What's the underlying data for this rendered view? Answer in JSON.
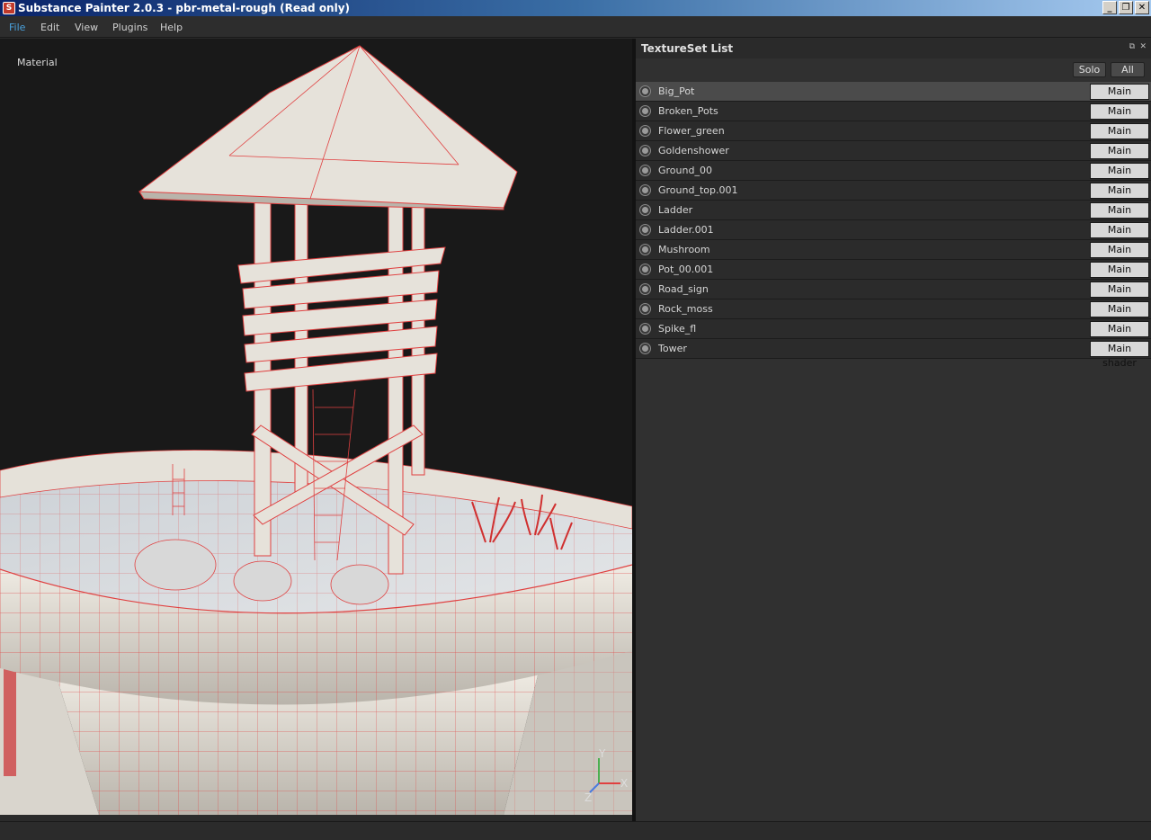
{
  "window": {
    "title": "Substance Painter 2.0.3 - pbr-metal-rough (Read only)",
    "app_icon": "substance-icon",
    "buttons": [
      "minimize",
      "restore",
      "close"
    ]
  },
  "menubar": {
    "items": [
      {
        "label": "File",
        "active": true
      },
      {
        "label": "Edit",
        "active": false
      },
      {
        "label": "View",
        "active": false
      },
      {
        "label": "Plugins",
        "active": false
      },
      {
        "label": "Help",
        "active": false
      }
    ]
  },
  "viewport": {
    "label": "Material",
    "axis": {
      "y": "Y",
      "x": "X",
      "z": "Z"
    },
    "colors": {
      "wireframe": "#e04040",
      "surface": "#e8e4dc",
      "background": "#191919"
    }
  },
  "textureset_panel": {
    "title": "TextureSet List",
    "solo_label": "Solo",
    "all_label": "All",
    "items": [
      {
        "name": "Big_Pot",
        "shader": "Main shader",
        "selected": true
      },
      {
        "name": "Broken_Pots",
        "shader": "Main shader",
        "selected": false
      },
      {
        "name": "Flower_green",
        "shader": "Main shader",
        "selected": false
      },
      {
        "name": "Goldenshower",
        "shader": "Main shader",
        "selected": false
      },
      {
        "name": "Ground_00",
        "shader": "Main shader",
        "selected": false
      },
      {
        "name": "Ground_top.001",
        "shader": "Main shader",
        "selected": false
      },
      {
        "name": "Ladder",
        "shader": "Main shader",
        "selected": false
      },
      {
        "name": "Ladder.001",
        "shader": "Main shader",
        "selected": false
      },
      {
        "name": "Mushroom",
        "shader": "Main shader",
        "selected": false
      },
      {
        "name": "Pot_00.001",
        "shader": "Main shader",
        "selected": false
      },
      {
        "name": "Road_sign",
        "shader": "Main shader",
        "selected": false
      },
      {
        "name": "Rock_moss",
        "shader": "Main shader",
        "selected": false
      },
      {
        "name": "Spike_fl",
        "shader": "Main shader",
        "selected": false
      },
      {
        "name": "Tower",
        "shader": "Main shader",
        "selected": false
      }
    ]
  }
}
